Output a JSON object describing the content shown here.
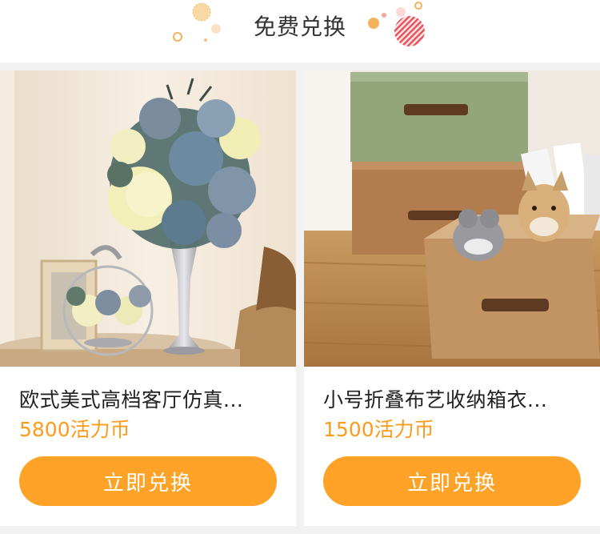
{
  "header": {
    "title": "免费兑换"
  },
  "products": [
    {
      "name": "欧式美式高档客厅仿真...",
      "price": "5800活力币",
      "button_label": "立即兑换"
    },
    {
      "name": "小号折叠布艺收纳箱衣...",
      "price": "1500活力币",
      "button_label": "立即兑换"
    }
  ],
  "colors": {
    "accent": "#ffa228",
    "price": "#ff9a1a",
    "deco_red": "#e8505b"
  }
}
